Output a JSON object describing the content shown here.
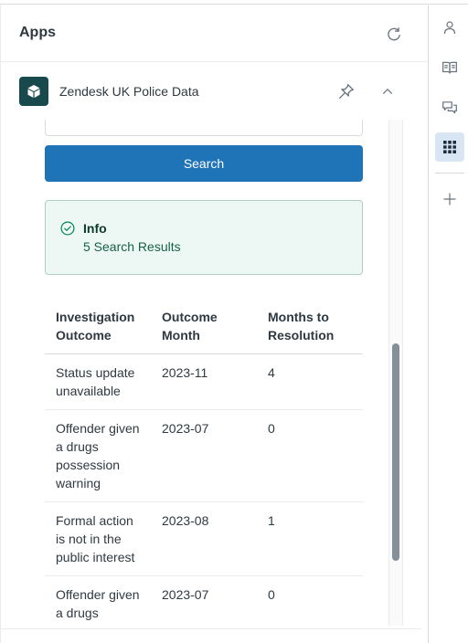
{
  "panel": {
    "title": "Apps"
  },
  "app": {
    "name": "Zendesk UK Police Data"
  },
  "search": {
    "value": "",
    "button_label": "Search"
  },
  "info": {
    "title": "Info",
    "message": "5 Search Results"
  },
  "table": {
    "headers": [
      "Investigation Outcome",
      "Outcome Month",
      "Months to Resolution"
    ],
    "rows": [
      [
        "Status update unavailable",
        "2023-11",
        "4"
      ],
      [
        "Offender given a drugs possession warning",
        "2023-07",
        "0"
      ],
      [
        "Formal action is not in the public interest",
        "2023-08",
        "1"
      ],
      [
        "Offender given a drugs possession warning",
        "2023-07",
        "0"
      ]
    ]
  },
  "rail": {
    "items": [
      "user-icon",
      "knowledge-book-icon",
      "conversations-icon",
      "apps-grid-icon",
      "add-icon"
    ],
    "active": "apps-grid-icon"
  },
  "colors": {
    "primary": "#1f73b7",
    "success_bg": "#edf8f4",
    "success_text": "#186146",
    "logo_bg": "#17494d"
  }
}
